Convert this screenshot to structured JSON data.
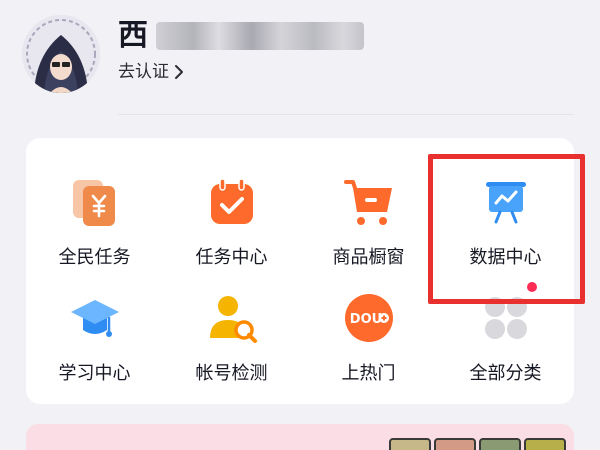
{
  "profile": {
    "name_first_char": "西",
    "verify_label": "去认证"
  },
  "grid": {
    "items": [
      {
        "label": "全民任务",
        "icon": "coupon-cards-icon"
      },
      {
        "label": "任务中心",
        "icon": "calendar-check-icon"
      },
      {
        "label": "商品橱窗",
        "icon": "shopping-cart-icon"
      },
      {
        "label": "数据中心",
        "icon": "data-board-icon"
      },
      {
        "label": "学习中心",
        "icon": "graduation-cap-icon"
      },
      {
        "label": "帐号检测",
        "icon": "account-search-icon"
      },
      {
        "label": "上热门",
        "icon": "dou-plus-icon"
      },
      {
        "label": "全部分类",
        "icon": "all-categories-icon"
      }
    ]
  },
  "colors": {
    "highlight_border": "#e8312f",
    "accent_orange": "#fe6a2b",
    "accent_blue": "#2f8cf3",
    "notification_dot": "#fe2c55",
    "banner_pink": "#fbdde6"
  }
}
